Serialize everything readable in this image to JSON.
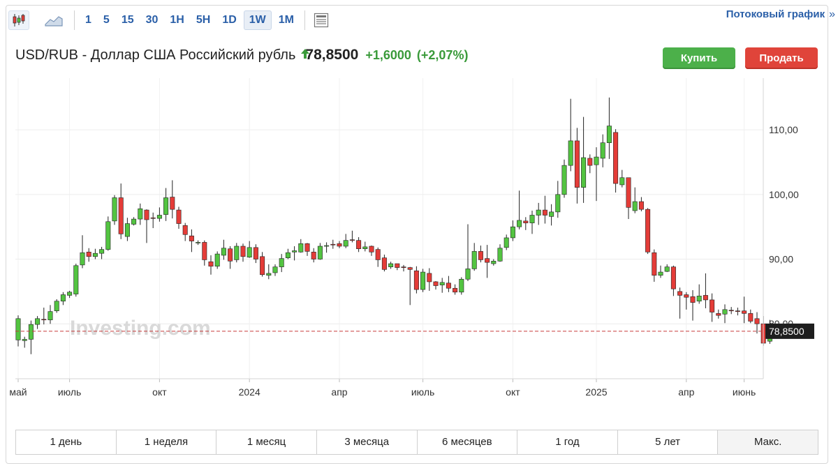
{
  "toolbar": {
    "chart_types": [
      {
        "name": "candlestick-chart-icon",
        "active": true
      },
      {
        "name": "area-chart-icon",
        "active": false
      }
    ],
    "intervals": [
      "1",
      "5",
      "15",
      "30",
      "1H",
      "5H",
      "1D",
      "1W",
      "1M"
    ],
    "active_interval": "1W",
    "settings_icon": "chart-settings-icon",
    "streaming_label": "Потоковый график",
    "streaming_chevron": "»"
  },
  "header": {
    "title": "USD/RUB - Доллар США Российский рубль",
    "direction": "up",
    "price": "78,8500",
    "change": "+1,6000",
    "change_pct": "(+2,07%)",
    "buy_label": "Купить",
    "sell_label": "Продать"
  },
  "watermark": "Investing.com",
  "colors": {
    "up": "#53c441",
    "down": "#e43c38",
    "price_line": "#c63a3a",
    "accent": "#2a5fa8"
  },
  "chart_data": {
    "type": "candlestick",
    "y_ticks": [
      "110,00",
      "100,00",
      "90,00",
      "80,00"
    ],
    "y_tick_values": [
      110,
      100,
      90,
      80
    ],
    "ylim": [
      71.5,
      118
    ],
    "x_labels": [
      "май",
      "июль",
      "окт",
      "2024",
      "апр",
      "июль",
      "окт",
      "2025",
      "апр",
      "июнь"
    ],
    "x_label_index": [
      0,
      8,
      22,
      36,
      50,
      63,
      77,
      90,
      104,
      113
    ],
    "last_price_label": "78,8500",
    "last_price": 78.85,
    "grid": true,
    "candles": [
      [
        77.5,
        80.8,
        76.5,
        81.3
      ],
      [
        77.4,
        77.6,
        76.3,
        78.0
      ],
      [
        77.6,
        79.9,
        75.3,
        80.5
      ],
      [
        79.9,
        80.8,
        79.2,
        81.2
      ],
      [
        80.7,
        80.6,
        79.9,
        82.5
      ],
      [
        80.6,
        81.9,
        80.0,
        82.9
      ],
      [
        82.0,
        83.5,
        81.7,
        83.8
      ],
      [
        83.5,
        84.5,
        82.9,
        84.9
      ],
      [
        84.4,
        84.9,
        84.0,
        85.1
      ],
      [
        84.6,
        89.0,
        84.2,
        89.3
      ],
      [
        89.1,
        91.0,
        88.6,
        93.7
      ],
      [
        91.1,
        90.4,
        89.6,
        91.7
      ],
      [
        90.4,
        90.9,
        90.0,
        91.6
      ],
      [
        90.9,
        91.5,
        90.0,
        91.9
      ],
      [
        91.5,
        95.8,
        91.3,
        96.6
      ],
      [
        95.9,
        99.5,
        95.3,
        99.9
      ],
      [
        99.5,
        93.9,
        93.1,
        101.7
      ],
      [
        93.5,
        95.5,
        92.8,
        96.4
      ],
      [
        95.4,
        96.2,
        95.2,
        96.5
      ],
      [
        96.2,
        97.8,
        95.3,
        98.6
      ],
      [
        97.6,
        96.1,
        92.5,
        97.7
      ],
      [
        96.4,
        96.3,
        94.8,
        97.2
      ],
      [
        96.3,
        96.8,
        95.8,
        98.0
      ],
      [
        96.9,
        99.5,
        95.9,
        101.0
      ],
      [
        99.6,
        97.7,
        96.3,
        102.2
      ],
      [
        97.6,
        95.5,
        94.7,
        98.1
      ],
      [
        95.2,
        93.8,
        92.8,
        95.6
      ],
      [
        93.6,
        92.8,
        91.1,
        94.6
      ],
      [
        92.6,
        92.6,
        92.2,
        92.9
      ],
      [
        92.6,
        89.9,
        89.0,
        92.9
      ],
      [
        89.6,
        88.9,
        87.6,
        90.6
      ],
      [
        88.9,
        90.8,
        88.5,
        91.2
      ],
      [
        90.6,
        91.7,
        89.9,
        93.0
      ],
      [
        91.6,
        89.7,
        88.5,
        92.0
      ],
      [
        89.9,
        92.0,
        89.5,
        92.5
      ],
      [
        92.0,
        90.4,
        89.6,
        92.4
      ],
      [
        90.3,
        91.8,
        90.2,
        92.8
      ],
      [
        91.8,
        90.0,
        89.4,
        92.3
      ],
      [
        90.4,
        87.6,
        87.3,
        91.1
      ],
      [
        87.5,
        87.8,
        86.9,
        89.2
      ],
      [
        87.9,
        88.8,
        87.4,
        89.2
      ],
      [
        88.8,
        90.1,
        88.0,
        90.8
      ],
      [
        90.2,
        91.0,
        90.0,
        91.6
      ],
      [
        91.1,
        91.3,
        89.8,
        92.0
      ],
      [
        91.1,
        92.4,
        91.0,
        93.1
      ],
      [
        92.4,
        91.2,
        90.5,
        92.5
      ],
      [
        91.1,
        90.0,
        89.5,
        91.7
      ],
      [
        90.0,
        92.0,
        89.9,
        92.5
      ],
      [
        92.0,
        92.1,
        91.0,
        92.6
      ],
      [
        92.3,
        92.2,
        91.6,
        93.0
      ],
      [
        92.4,
        92.0,
        91.7,
        92.8
      ],
      [
        92.0,
        92.9,
        91.7,
        93.9
      ],
      [
        93.0,
        92.9,
        92.6,
        94.4
      ],
      [
        92.9,
        91.6,
        91.1,
        93.4
      ],
      [
        91.6,
        91.9,
        91.2,
        92.7
      ],
      [
        92.0,
        91.1,
        90.5,
        92.1
      ],
      [
        91.5,
        89.9,
        88.8,
        91.8
      ],
      [
        90.2,
        88.4,
        88.1,
        90.7
      ],
      [
        88.8,
        89.3,
        88.5,
        89.6
      ],
      [
        89.3,
        88.7,
        88.3,
        89.2
      ],
      [
        88.8,
        88.7,
        88.1,
        89.1
      ],
      [
        88.7,
        88.4,
        82.9,
        88.8
      ],
      [
        88.2,
        85.3,
        84.7,
        88.9
      ],
      [
        85.3,
        88.0,
        84.9,
        88.5
      ],
      [
        87.8,
        86.5,
        85.1,
        88.6
      ],
      [
        86.5,
        85.9,
        85.3,
        86.6
      ],
      [
        86.0,
        86.4,
        84.8,
        87.1
      ],
      [
        86.3,
        85.5,
        84.9,
        87.4
      ],
      [
        85.5,
        84.9,
        84.5,
        86.1
      ],
      [
        84.9,
        86.9,
        84.5,
        87.2
      ],
      [
        86.9,
        88.5,
        86.6,
        95.4
      ],
      [
        88.5,
        91.2,
        88.2,
        92.5
      ],
      [
        91.2,
        89.9,
        89.5,
        92.1
      ],
      [
        90.1,
        89.5,
        87.1,
        92.2
      ],
      [
        89.3,
        89.7,
        89.0,
        90.0
      ],
      [
        89.7,
        91.7,
        89.6,
        92.3
      ],
      [
        91.8,
        93.3,
        91.4,
        93.8
      ],
      [
        93.3,
        95.0,
        92.8,
        96.0
      ],
      [
        95.0,
        96.0,
        94.6,
        100.6
      ],
      [
        95.9,
        95.6,
        94.5,
        96.5
      ],
      [
        95.6,
        96.8,
        93.9,
        97.5
      ],
      [
        96.8,
        97.6,
        95.3,
        98.7
      ],
      [
        97.6,
        96.8,
        95.5,
        99.8
      ],
      [
        96.6,
        97.3,
        95.2,
        98.5
      ],
      [
        97.3,
        100.0,
        96.4,
        102.1
      ],
      [
        100.0,
        104.5,
        99.5,
        105.4
      ],
      [
        104.5,
        108.3,
        103.6,
        114.8
      ],
      [
        108.3,
        101.1,
        98.6,
        110.3
      ],
      [
        101.1,
        105.7,
        98.7,
        112.0
      ],
      [
        105.6,
        104.5,
        103.3,
        106.2
      ],
      [
        104.6,
        105.8,
        99.0,
        107.3
      ],
      [
        105.6,
        108.0,
        104.2,
        109.3
      ],
      [
        108.0,
        110.6,
        105.5,
        115.0
      ],
      [
        109.6,
        101.7,
        100.3,
        110.1
      ],
      [
        101.5,
        102.6,
        101.1,
        103.8
      ],
      [
        102.6,
        98.0,
        96.2,
        102.6
      ],
      [
        97.5,
        98.9,
        97.1,
        101.1
      ],
      [
        98.9,
        97.7,
        97.4,
        99.6
      ],
      [
        97.7,
        91.1,
        90.8,
        97.9
      ],
      [
        91.0,
        87.5,
        86.5,
        91.5
      ],
      [
        87.5,
        88.0,
        87.1,
        89.0
      ],
      [
        88.1,
        88.8,
        88.0,
        89.2
      ],
      [
        88.8,
        85.4,
        84.3,
        89.0
      ],
      [
        85.0,
        84.4,
        80.8,
        85.6
      ],
      [
        84.5,
        84.1,
        82.2,
        84.9
      ],
      [
        84.2,
        83.3,
        80.5,
        85.2
      ],
      [
        83.5,
        84.3,
        83.1,
        86.1
      ],
      [
        84.4,
        83.7,
        82.4,
        87.8
      ],
      [
        83.7,
        81.8,
        80.3,
        84.7
      ],
      [
        81.6,
        81.3,
        80.8,
        82.2
      ],
      [
        81.5,
        82.2,
        80.1,
        83.0
      ],
      [
        82.1,
        82.0,
        81.5,
        82.6
      ],
      [
        82.0,
        81.9,
        81.3,
        82.5
      ],
      [
        82.0,
        81.6,
        80.1,
        84.2
      ],
      [
        81.6,
        80.4,
        80.1,
        82.2
      ],
      [
        80.8,
        80.0,
        78.5,
        81.8
      ],
      [
        80.0,
        77.0,
        76.6,
        81.2
      ],
      [
        77.3,
        78.7,
        76.9,
        80.6
      ]
    ]
  },
  "range_buttons": [
    "1 день",
    "1 неделя",
    "1 месяц",
    "3 месяца",
    "6 месяцев",
    "1 год",
    "5 лет",
    "Макс."
  ]
}
